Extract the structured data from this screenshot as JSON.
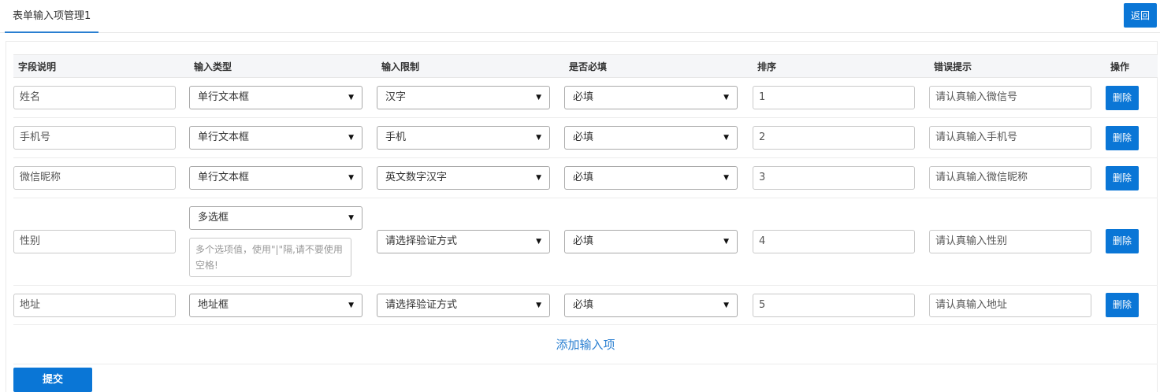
{
  "tab": {
    "title": "表单输入项管理1"
  },
  "back_label": "返回",
  "headers": [
    "字段说明",
    "输入类型",
    "输入限制",
    "是否必填",
    "排序",
    "错误提示",
    "操作"
  ],
  "rows": [
    {
      "label": "姓名",
      "type": "单行文本框",
      "limit": "汉字",
      "required": "必填",
      "order": "1",
      "error": "请认真输入微信号",
      "delete": "删除"
    },
    {
      "label": "手机号",
      "type": "单行文本框",
      "limit": "手机",
      "required": "必填",
      "order": "2",
      "error": "请认真输入手机号",
      "delete": "删除"
    },
    {
      "label": "微信昵称",
      "type": "单行文本框",
      "limit": "英文数字汉字",
      "required": "必填",
      "order": "3",
      "error": "请认真输入微信昵称",
      "delete": "删除"
    },
    {
      "label": "性别",
      "type": "多选框",
      "options_placeholder": "多个选项值，使用\"|\"隔,请不要使用空格!",
      "limit": "请选择验证方式",
      "required": "必填",
      "order": "4",
      "error": "请认真输入性别",
      "delete": "删除"
    },
    {
      "label": "地址",
      "type": "地址框",
      "limit": "请选择验证方式",
      "required": "必填",
      "order": "5",
      "error": "请认真输入地址",
      "delete": "删除"
    }
  ],
  "add_label": "添加输入项",
  "submit_label": "提交",
  "colors": {
    "primary": "#0a76d6",
    "link": "#2a7fd1"
  }
}
